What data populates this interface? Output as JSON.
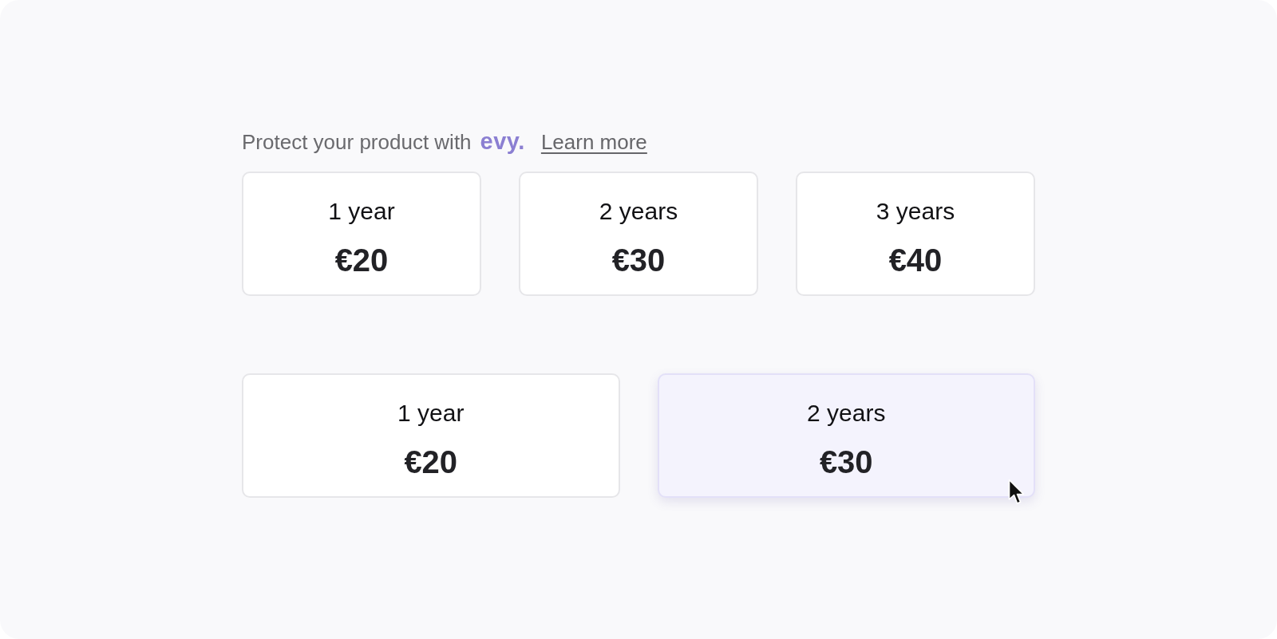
{
  "header": {
    "text": "Protect your product with",
    "logo": "evy.",
    "link": "Learn more"
  },
  "plan_rows": [
    {
      "plans": [
        {
          "term": "1 year",
          "price": "€20",
          "selected": false
        },
        {
          "term": "2 years",
          "price": "€30",
          "selected": false
        },
        {
          "term": "3 years",
          "price": "€40",
          "selected": false
        }
      ]
    },
    {
      "plans": [
        {
          "term": "1 year",
          "price": "€20",
          "selected": false
        },
        {
          "term": "2 years",
          "price": "€30",
          "selected": true
        }
      ]
    }
  ]
}
